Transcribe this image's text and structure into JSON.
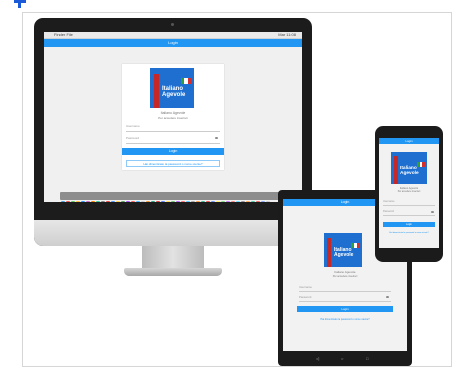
{
  "app": {
    "bar_title": "Login",
    "logo_text_line1": "Italiano",
    "logo_text_line2": "Agevole",
    "subtitle": "Italiano Agevole",
    "subtitle_sub": "Per accedere inserisci",
    "username_placeholder": "Username",
    "password_placeholder": "Password",
    "login_button": "Login",
    "forgot_link": "Hai dimenticato la password o nome utente?"
  },
  "mac": {
    "menu_left": "Finder File",
    "menu_right": "Mar 11:08"
  },
  "colors": {
    "accent": "#2196f3",
    "logo_blue": "#1e6fd0",
    "ribbon_red": "#c62828"
  },
  "icons": [
    "camera-icon",
    "dock-app-icon",
    "back-icon",
    "home-icon",
    "recents-icon",
    "eye-icon"
  ]
}
